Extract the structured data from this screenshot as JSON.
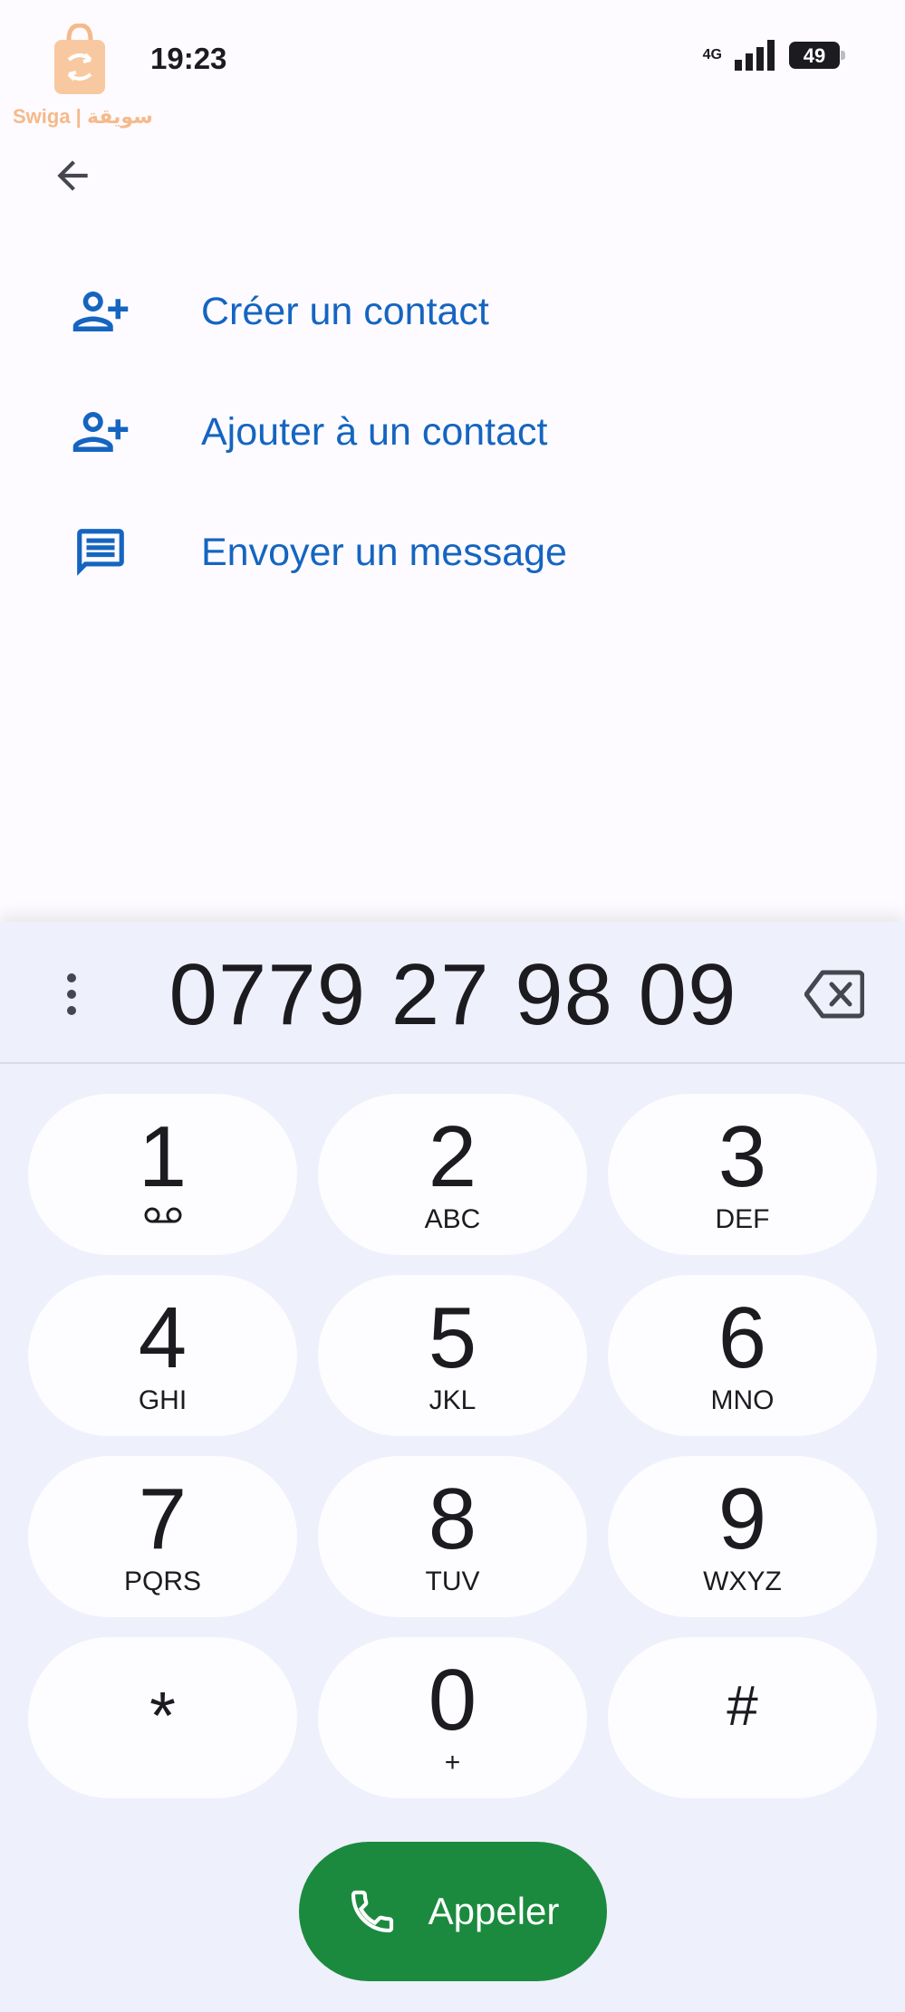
{
  "status_bar": {
    "time": "19:23",
    "network": "4G",
    "battery": "49"
  },
  "watermark": {
    "text": "Swiga | سويقة"
  },
  "actions": [
    {
      "label": "Créer un contact",
      "icon": "person-add-icon"
    },
    {
      "label": "Ajouter à un contact",
      "icon": "person-add-icon"
    },
    {
      "label": "Envoyer un message",
      "icon": "message-icon"
    }
  ],
  "dialer": {
    "number": "0779 27 98 09",
    "keys": [
      {
        "digit": "1",
        "sub": ""
      },
      {
        "digit": "2",
        "sub": "ABC"
      },
      {
        "digit": "3",
        "sub": "DEF"
      },
      {
        "digit": "4",
        "sub": "GHI"
      },
      {
        "digit": "5",
        "sub": "JKL"
      },
      {
        "digit": "6",
        "sub": "MNO"
      },
      {
        "digit": "7",
        "sub": "PQRS"
      },
      {
        "digit": "8",
        "sub": "TUV"
      },
      {
        "digit": "9",
        "sub": "WXYZ"
      },
      {
        "digit": "*",
        "sub": ""
      },
      {
        "digit": "0",
        "sub": "+"
      },
      {
        "digit": "#",
        "sub": ""
      }
    ],
    "call_label": "Appeler"
  },
  "colors": {
    "accent": "#1565c0",
    "call": "#1b8a3e",
    "panel": "#eef0fb"
  }
}
